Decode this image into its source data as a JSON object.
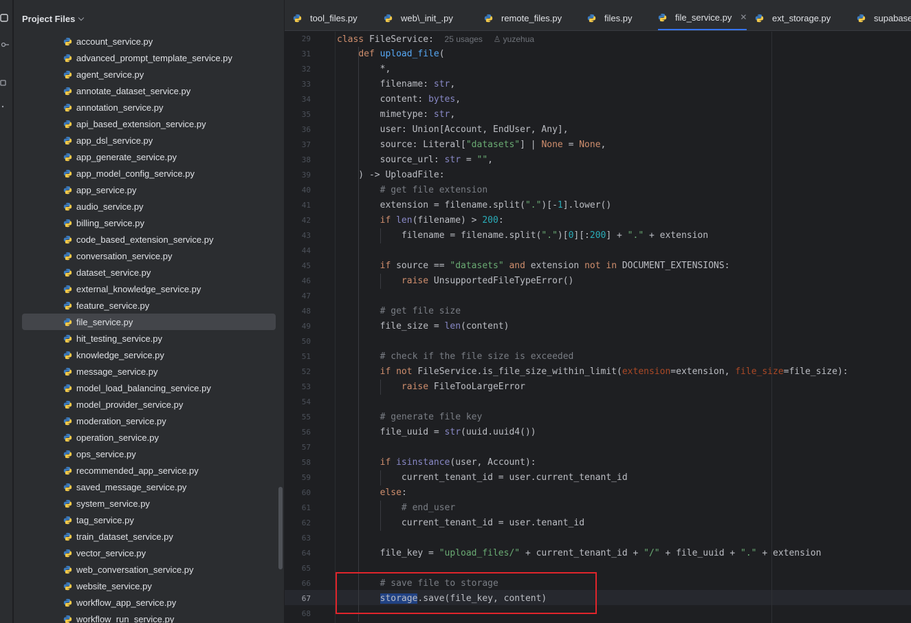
{
  "panel": {
    "title": "Project Files",
    "files": [
      "account_service.py",
      "advanced_prompt_template_service.py",
      "agent_service.py",
      "annotate_dataset_service.py",
      "annotation_service.py",
      "api_based_extension_service.py",
      "app_dsl_service.py",
      "app_generate_service.py",
      "app_model_config_service.py",
      "app_service.py",
      "audio_service.py",
      "billing_service.py",
      "code_based_extension_service.py",
      "conversation_service.py",
      "dataset_service.py",
      "external_knowledge_service.py",
      "feature_service.py",
      "file_service.py",
      "hit_testing_service.py",
      "knowledge_service.py",
      "message_service.py",
      "model_load_balancing_service.py",
      "model_provider_service.py",
      "moderation_service.py",
      "operation_service.py",
      "ops_service.py",
      "recommended_app_service.py",
      "saved_message_service.py",
      "system_service.py",
      "tag_service.py",
      "train_dataset_service.py",
      "vector_service.py",
      "web_conversation_service.py",
      "website_service.py",
      "workflow_app_service.py",
      "workflow_run_service.py"
    ],
    "selected_file": "file_service.py"
  },
  "tabs": [
    {
      "label": "tool_files.py"
    },
    {
      "label": "web\\_init_.py"
    },
    {
      "label": "remote_files.py"
    },
    {
      "label": "files.py"
    },
    {
      "label": "file_service.py",
      "active": true
    },
    {
      "label": "ext_storage.py"
    },
    {
      "label": "supabase_"
    }
  ],
  "editor": {
    "class_line": {
      "number": "29",
      "text": "class FileService:",
      "usages": "25 usages",
      "author": "yuzehua"
    },
    "lines": [
      {
        "n": "31",
        "text": "    def upload_file("
      },
      {
        "n": "32",
        "text": "        *,"
      },
      {
        "n": "33",
        "text": "        filename: str,"
      },
      {
        "n": "34",
        "text": "        content: bytes,"
      },
      {
        "n": "35",
        "text": "        mimetype: str,"
      },
      {
        "n": "36",
        "text": "        user: Union[Account, EndUser, Any],"
      },
      {
        "n": "37",
        "text": "        source: Literal[\"datasets\"] | None = None,"
      },
      {
        "n": "38",
        "text": "        source_url: str = \"\","
      },
      {
        "n": "39",
        "text": "    ) -> UploadFile:"
      },
      {
        "n": "40",
        "text": "        # get file extension"
      },
      {
        "n": "41",
        "text": "        extension = filename.split(\".\")[-1].lower()"
      },
      {
        "n": "42",
        "text": "        if len(filename) > 200:"
      },
      {
        "n": "43",
        "text": "            filename = filename.split(\".\")[0][:200] + \".\" + extension"
      },
      {
        "n": "44",
        "text": ""
      },
      {
        "n": "45",
        "text": "        if source == \"datasets\" and extension not in DOCUMENT_EXTENSIONS:"
      },
      {
        "n": "46",
        "text": "            raise UnsupportedFileTypeError()"
      },
      {
        "n": "47",
        "text": ""
      },
      {
        "n": "48",
        "text": "        # get file size"
      },
      {
        "n": "49",
        "text": "        file_size = len(content)"
      },
      {
        "n": "50",
        "text": ""
      },
      {
        "n": "51",
        "text": "        # check if the file size is exceeded"
      },
      {
        "n": "52",
        "text": "        if not FileService.is_file_size_within_limit(extension=extension, file_size=file_size):"
      },
      {
        "n": "53",
        "text": "            raise FileTooLargeError"
      },
      {
        "n": "54",
        "text": ""
      },
      {
        "n": "55",
        "text": "        # generate file key"
      },
      {
        "n": "56",
        "text": "        file_uuid = str(uuid.uuid4())"
      },
      {
        "n": "57",
        "text": ""
      },
      {
        "n": "58",
        "text": "        if isinstance(user, Account):"
      },
      {
        "n": "59",
        "text": "            current_tenant_id = user.current_tenant_id"
      },
      {
        "n": "60",
        "text": "        else:"
      },
      {
        "n": "61",
        "text": "            # end_user"
      },
      {
        "n": "62",
        "text": "            current_tenant_id = user.tenant_id"
      },
      {
        "n": "63",
        "text": ""
      },
      {
        "n": "64",
        "text": "        file_key = \"upload_files/\" + current_tenant_id + \"/\" + file_uuid + \".\" + extension"
      },
      {
        "n": "65",
        "text": ""
      },
      {
        "n": "66",
        "text": "        # save file to storage"
      },
      {
        "n": "67",
        "text": "        storage.save(file_key, content)"
      },
      {
        "n": "68",
        "text": ""
      }
    ],
    "current_line": "67"
  },
  "colors": {
    "background": "#1e1f22",
    "panel": "#2b2d30",
    "keyword": "#cf8e6d",
    "function": "#56a8f5",
    "string": "#6aab73",
    "number": "#2aacb8",
    "comment": "#7a7e85",
    "parameter_hint": "#aa4926",
    "selection": "#214283",
    "annotation_box": "#e0252b",
    "active_tab_underline": "#3574f0"
  },
  "icons": {
    "file": "python-file-icon",
    "panel_toggle": "chevron-down-icon",
    "tab_close": "close-icon"
  }
}
